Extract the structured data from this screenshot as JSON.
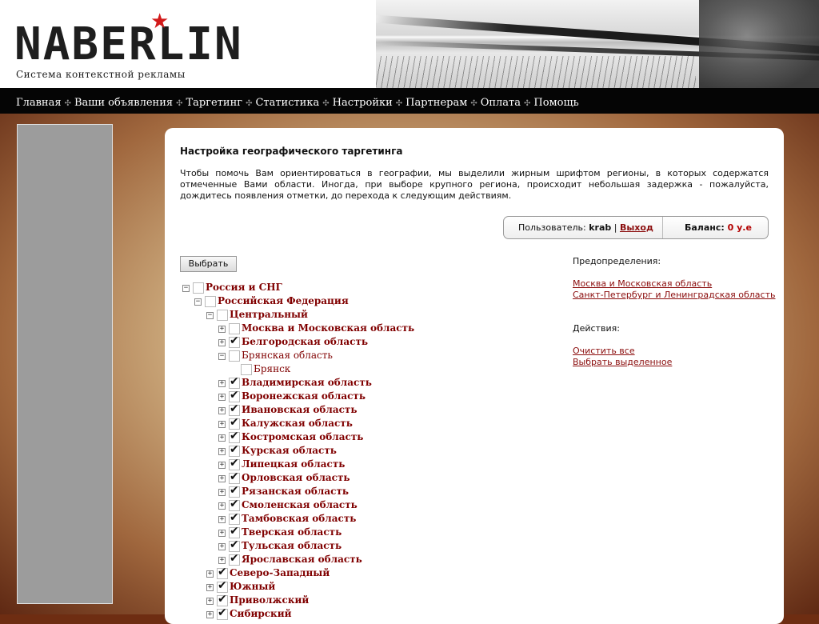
{
  "header": {
    "logo": "NABERLIN",
    "tagline": "Система контекстной рекламы"
  },
  "nav": [
    "Главная",
    "Ваши объявления",
    "Таргетинг",
    "Статистика",
    "Настройки",
    "Партнерам",
    "Оплата",
    "Помощь"
  ],
  "main": {
    "title": "Настройка географического таргетинга",
    "intro": "Чтобы помочь Вам ориентироваться в географии, мы выделили жирным шрифтом регионы, в которых содержатся отмеченные Вами области. Иногда, при выборе крупного региона, происходит небольшая задержка - пожалуйста, дождитесь появления отметки, до перехода к следующим действиям.",
    "select_button": "Выбрать"
  },
  "userbox": {
    "user_label": "Пользователь:",
    "username": "krab",
    "logout": "Выход",
    "balance_label": "Баланс:",
    "balance_value": "0 у.е"
  },
  "presets": {
    "heading": "Предопределения:",
    "items": [
      "Москва и Московская область",
      "Санкт-Петербург и Ленинградская область"
    ]
  },
  "actions": {
    "heading": "Действия:",
    "items": [
      "Очистить все",
      "Выбрать выделенное"
    ]
  },
  "tree": [
    {
      "label": "Россия и СНГ",
      "level": 0,
      "toggle": "−",
      "checked": false,
      "bold": true
    },
    {
      "label": "Российская Федерация",
      "level": 1,
      "toggle": "−",
      "checked": false,
      "bold": true
    },
    {
      "label": "Центральный",
      "level": 2,
      "toggle": "−",
      "checked": false,
      "bold": true
    },
    {
      "label": "Москва и Московская область",
      "level": 3,
      "toggle": "+",
      "checked": false,
      "bold": true
    },
    {
      "label": "Белгородская область",
      "level": 3,
      "toggle": "+",
      "checked": true,
      "bold": true
    },
    {
      "label": "Брянская область",
      "level": 3,
      "toggle": "−",
      "checked": false,
      "bold": false
    },
    {
      "label": "Брянск",
      "level": 4,
      "toggle": "",
      "checked": false,
      "bold": false
    },
    {
      "label": "Владимирская область",
      "level": 3,
      "toggle": "+",
      "checked": true,
      "bold": true
    },
    {
      "label": "Воронежская область",
      "level": 3,
      "toggle": "+",
      "checked": true,
      "bold": true
    },
    {
      "label": "Ивановская область",
      "level": 3,
      "toggle": "+",
      "checked": true,
      "bold": true
    },
    {
      "label": "Калужская область",
      "level": 3,
      "toggle": "+",
      "checked": true,
      "bold": true
    },
    {
      "label": "Костромская область",
      "level": 3,
      "toggle": "+",
      "checked": true,
      "bold": true
    },
    {
      "label": "Курская область",
      "level": 3,
      "toggle": "+",
      "checked": true,
      "bold": true
    },
    {
      "label": "Липецкая область",
      "level": 3,
      "toggle": "+",
      "checked": true,
      "bold": true
    },
    {
      "label": "Орловская область",
      "level": 3,
      "toggle": "+",
      "checked": true,
      "bold": true
    },
    {
      "label": "Рязанская область",
      "level": 3,
      "toggle": "+",
      "checked": true,
      "bold": true
    },
    {
      "label": "Смоленская область",
      "level": 3,
      "toggle": "+",
      "checked": true,
      "bold": true
    },
    {
      "label": "Тамбовская область",
      "level": 3,
      "toggle": "+",
      "checked": true,
      "bold": true
    },
    {
      "label": "Тверская область",
      "level": 3,
      "toggle": "+",
      "checked": true,
      "bold": true
    },
    {
      "label": "Тульская область",
      "level": 3,
      "toggle": "+",
      "checked": true,
      "bold": true
    },
    {
      "label": "Ярославская область",
      "level": 3,
      "toggle": "+",
      "checked": true,
      "bold": true
    },
    {
      "label": "Северо-Западный",
      "level": 2,
      "toggle": "+",
      "checked": true,
      "bold": true
    },
    {
      "label": "Южный",
      "level": 2,
      "toggle": "+",
      "checked": true,
      "bold": true
    },
    {
      "label": "Приволжский",
      "level": 2,
      "toggle": "+",
      "checked": true,
      "bold": true
    },
    {
      "label": "Сибирский",
      "level": 2,
      "toggle": "+",
      "checked": true,
      "bold": true
    }
  ],
  "colors": {
    "link": "#8b0d0d",
    "accent_star": "#d21a1a",
    "nav_bg": "#050505"
  }
}
